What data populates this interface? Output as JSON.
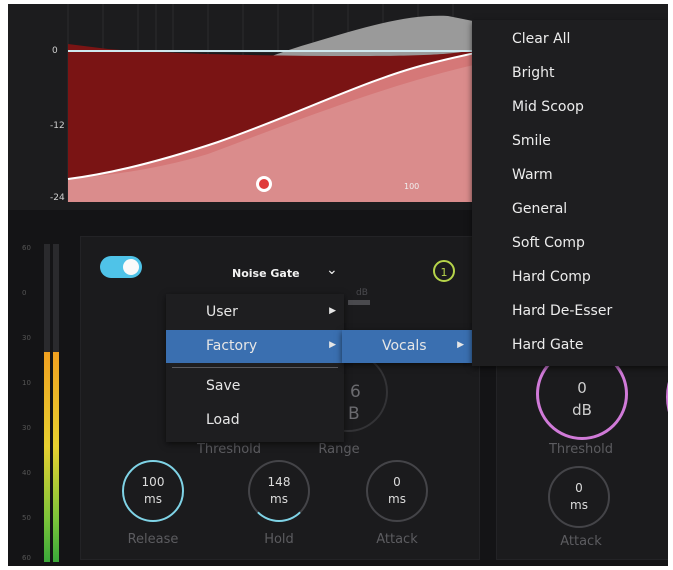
{
  "graph": {
    "y_labels": [
      "0",
      "-12",
      "-24"
    ],
    "freq_label": "100",
    "colors": {
      "red_fill": "#7a1414",
      "pink_fill": "#e58a8a",
      "gray_fill": "#9a9a9a",
      "curve": "#ffffff",
      "marker": "#e03a3a"
    }
  },
  "meter": {
    "scale": [
      "60",
      "0",
      "30",
      "10",
      "30",
      "40",
      "50",
      "60"
    ]
  },
  "module": {
    "title": "Noise Gate",
    "badge": "1",
    "faint_dB": "dB",
    "range_value": "6",
    "range_unit": "B",
    "labels": {
      "threshold": "Threshold",
      "range": "Range"
    },
    "knobs": [
      {
        "value": "100",
        "unit": "ms",
        "label": "Release"
      },
      {
        "value": "148",
        "unit": "ms",
        "label": "Hold"
      },
      {
        "value": "0",
        "unit": "ms",
        "label": "Attack"
      }
    ]
  },
  "module2": {
    "threshold": {
      "value": "0",
      "unit": "dB",
      "label": "Threshold"
    },
    "attack": {
      "value": "0",
      "unit": "ms",
      "label": "Attack"
    }
  },
  "preset_menu": {
    "items": [
      {
        "label": "User",
        "has_submenu": true
      },
      {
        "label": "Factory",
        "has_submenu": true
      },
      {
        "label": "Save",
        "has_submenu": false
      },
      {
        "label": "Load",
        "has_submenu": false
      }
    ]
  },
  "factory_submenu": {
    "items": [
      {
        "label": "Vocals",
        "has_submenu": true
      }
    ]
  },
  "vocals_submenu": {
    "items": [
      "Clear All",
      "Bright",
      "Mid Scoop",
      "Smile",
      "Warm",
      "General",
      "Soft Comp",
      "Hard Comp",
      "Hard De-Esser",
      "Hard Gate"
    ]
  }
}
